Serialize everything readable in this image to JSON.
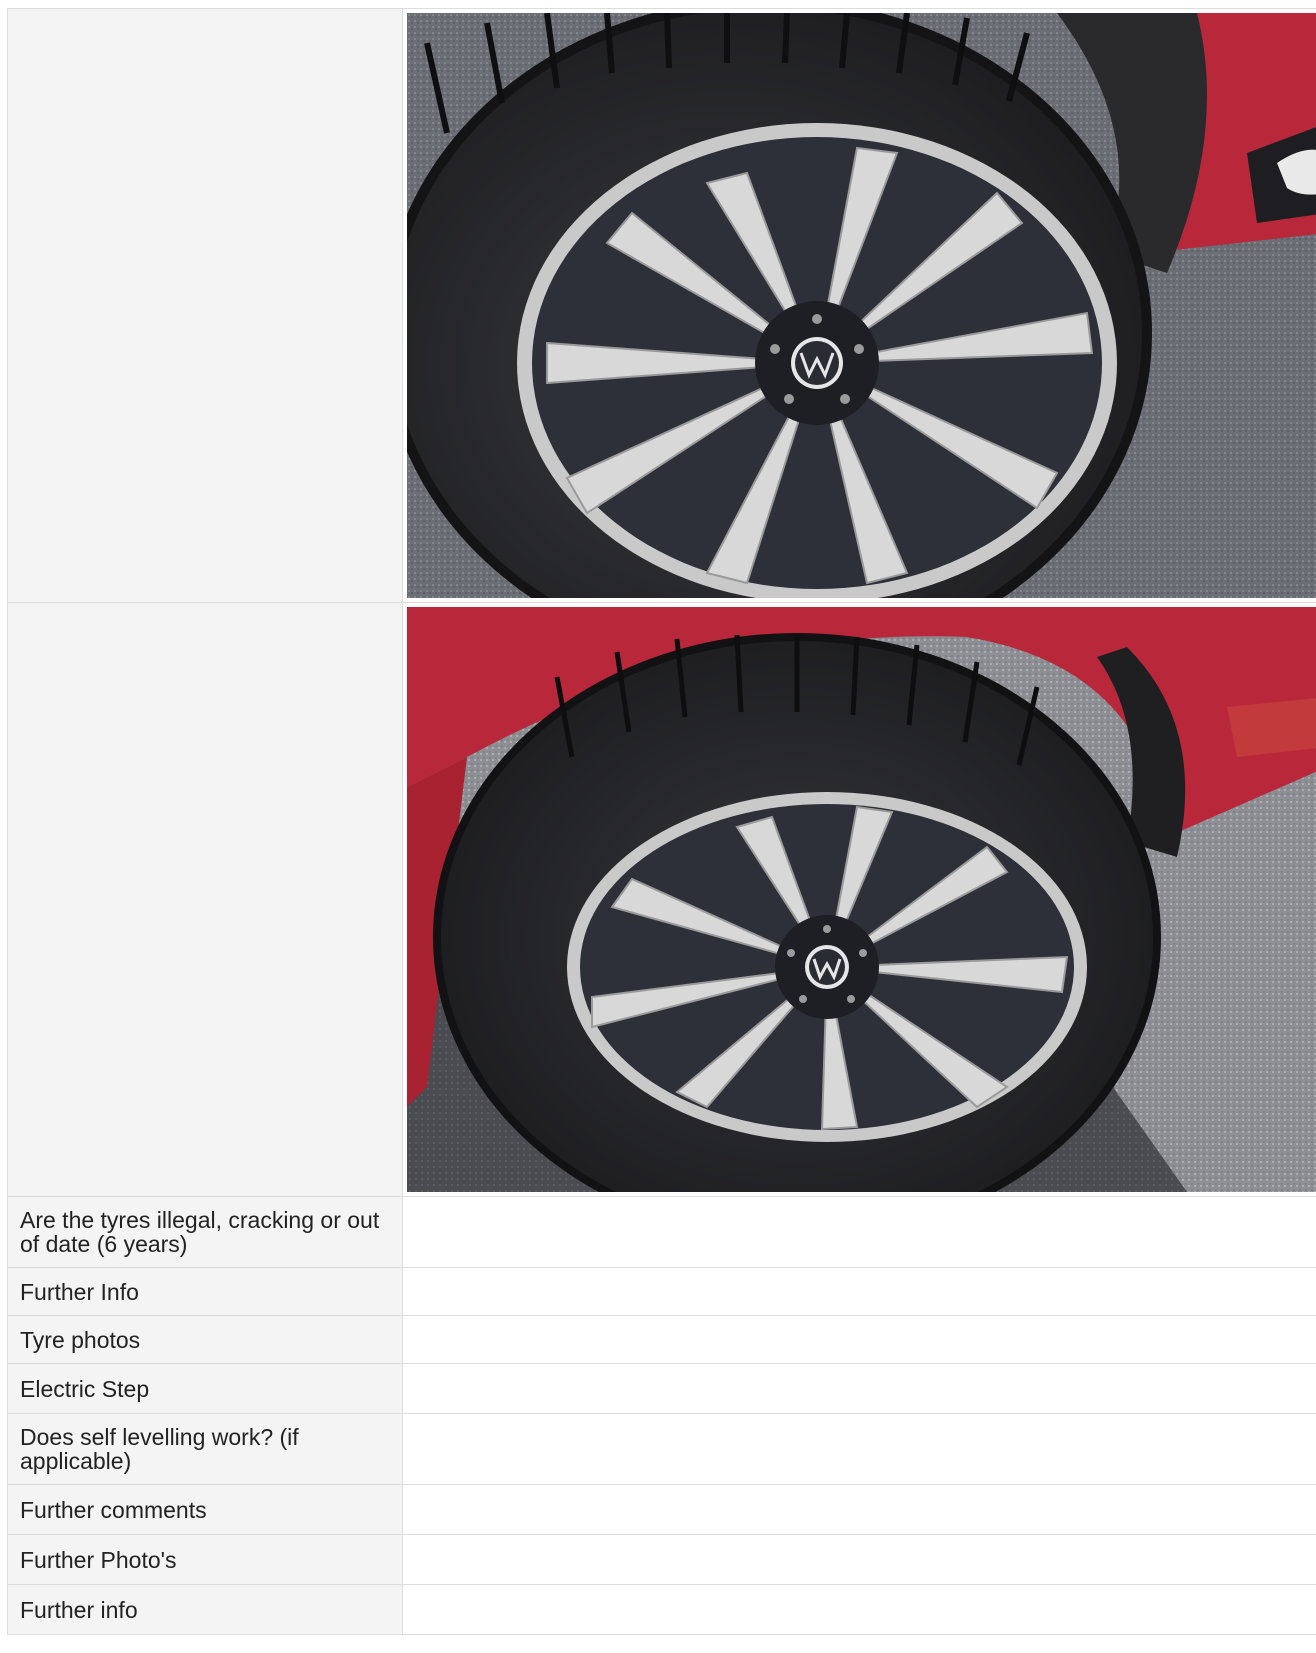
{
  "photos": [
    {
      "alt": "tyre-photo-1"
    },
    {
      "alt": "tyre-photo-2"
    }
  ],
  "rows": {
    "tyres_illegal": "Are the tyres illegal, cracking or out of date (6 years)",
    "further_info_1": "Further Info",
    "tyre_photos": "Tyre photos",
    "electric_step": "Electric Step",
    "self_levelling": "Does self levelling work? (if applicable)",
    "further_comments": "Further comments",
    "further_photos": "Further Photo's",
    "further_info_2": "Further info"
  },
  "colors": {
    "label_bg": "#f4f4f4",
    "border": "#dcdcdc",
    "car_body": "#b8283a",
    "asphalt": "#5f6268"
  }
}
